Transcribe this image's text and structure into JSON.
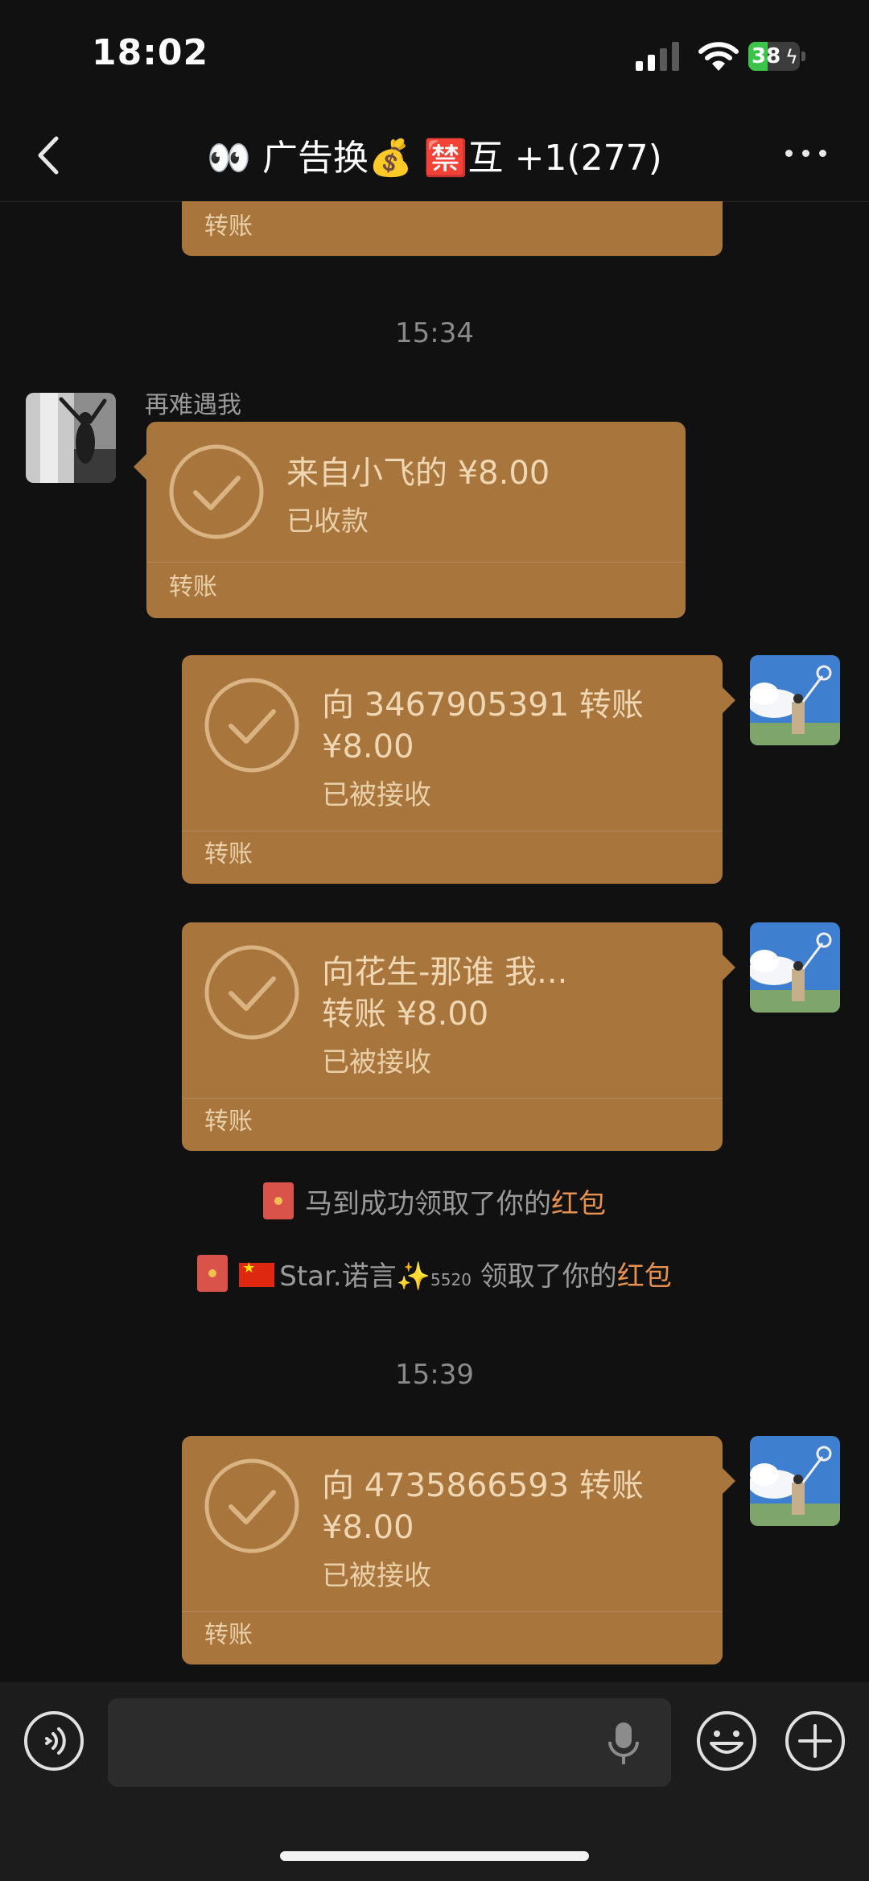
{
  "status_bar": {
    "time": "18:02",
    "battery_level": "38",
    "battery_fraction": 0.38,
    "battery_color": "#3bc34a"
  },
  "header": {
    "title_prefix": "👀 广告换💰 🈲互",
    "title_suffix": "+1(277)",
    "icons": [
      "back-chevron-icon",
      "more-dots-icon"
    ]
  },
  "colors": {
    "transfer_card": "#a8753d",
    "red_packet_highlight": "#e8914e",
    "background": "#111111"
  },
  "messages": [
    {
      "type": "transfer_partial",
      "footer": "转账"
    },
    {
      "type": "timestamp",
      "text": "15:34"
    },
    {
      "type": "transfer",
      "direction": "incoming",
      "sender": "再难遇我",
      "main": "来自小飞的 ¥8.00",
      "status": "已收款",
      "footer": "转账"
    },
    {
      "type": "transfer",
      "direction": "outgoing",
      "line1": "向 3467905391 转账",
      "line2": "¥8.00",
      "status": "已被接收",
      "footer": "转账"
    },
    {
      "type": "transfer",
      "direction": "outgoing",
      "line1": "向花生-那谁  我...",
      "line2": "转账 ¥8.00",
      "status": "已被接收",
      "footer": "转账"
    },
    {
      "type": "system",
      "before": "马到成功领取了你的",
      "highlight": "红包"
    },
    {
      "type": "system",
      "name": "Star.诺言✨",
      "small": "5520",
      "before": " 领取了你的",
      "highlight": "红包"
    },
    {
      "type": "timestamp",
      "text": "15:39"
    },
    {
      "type": "transfer",
      "direction": "outgoing",
      "line1": "向 4735866593 转账",
      "line2": "¥8.00",
      "status": "已被接收",
      "footer": "转账"
    }
  ],
  "input_bar": {
    "icons": [
      "voice-icon",
      "mic-icon",
      "emoji-icon",
      "add-icon"
    ]
  }
}
